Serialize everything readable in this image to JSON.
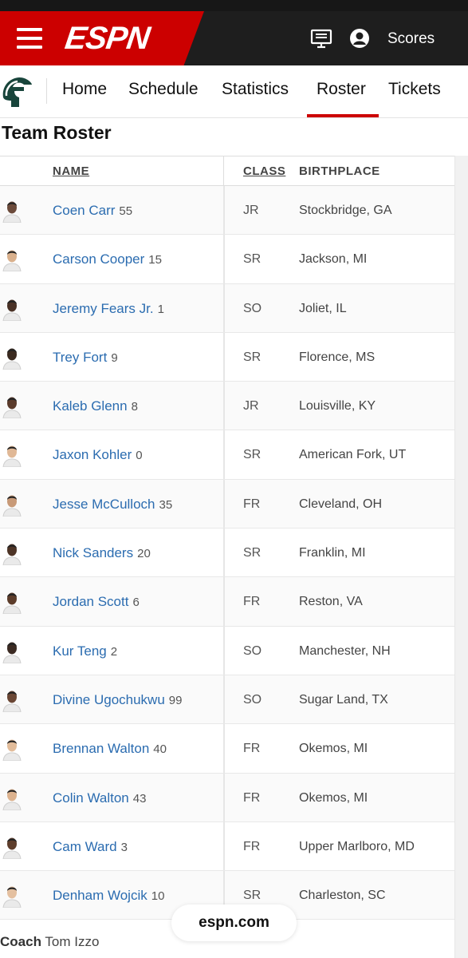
{
  "header": {
    "logo_text": "ESPN",
    "scores_label": "Scores"
  },
  "subnav": {
    "items": [
      "Home",
      "Schedule",
      "Statistics",
      "Roster",
      "Tickets"
    ],
    "active": "Roster"
  },
  "page_title": "Team Roster",
  "table": {
    "columns": [
      "NAME",
      "CLASS",
      "BIRTHPLACE"
    ],
    "rows": [
      {
        "name": "Coen Carr",
        "number": "55",
        "class": "JR",
        "birthplace": "Stockbridge, GA"
      },
      {
        "name": "Carson Cooper",
        "number": "15",
        "class": "SR",
        "birthplace": "Jackson, MI"
      },
      {
        "name": "Jeremy Fears Jr.",
        "number": "1",
        "class": "SO",
        "birthplace": "Joliet, IL"
      },
      {
        "name": "Trey Fort",
        "number": "9",
        "class": "SR",
        "birthplace": "Florence, MS"
      },
      {
        "name": "Kaleb Glenn",
        "number": "8",
        "class": "JR",
        "birthplace": "Louisville, KY"
      },
      {
        "name": "Jaxon Kohler",
        "number": "0",
        "class": "SR",
        "birthplace": "American Fork, UT"
      },
      {
        "name": "Jesse McCulloch",
        "number": "35",
        "class": "FR",
        "birthplace": "Cleveland, OH"
      },
      {
        "name": "Nick Sanders",
        "number": "20",
        "class": "SR",
        "birthplace": "Franklin, MI"
      },
      {
        "name": "Jordan Scott",
        "number": "6",
        "class": "FR",
        "birthplace": "Reston, VA"
      },
      {
        "name": "Kur Teng",
        "number": "2",
        "class": "SO",
        "birthplace": "Manchester, NH"
      },
      {
        "name": "Divine Ugochukwu",
        "number": "99",
        "class": "SO",
        "birthplace": "Sugar Land, TX"
      },
      {
        "name": "Brennan Walton",
        "number": "40",
        "class": "FR",
        "birthplace": "Okemos, MI"
      },
      {
        "name": "Colin Walton",
        "number": "43",
        "class": "FR",
        "birthplace": "Okemos, MI"
      },
      {
        "name": "Cam Ward",
        "number": "3",
        "class": "FR",
        "birthplace": "Upper Marlboro, MD"
      },
      {
        "name": "Denham Wojcik",
        "number": "10",
        "class": "SR",
        "birthplace": "Charleston, SC"
      }
    ]
  },
  "coach": {
    "label": "Coach",
    "name": "Tom Izzo"
  },
  "url_pill": "espn.com",
  "colors": {
    "brand_red": "#cc0000",
    "link_blue": "#2b6cb0",
    "topbar": "#1e1e1e"
  }
}
